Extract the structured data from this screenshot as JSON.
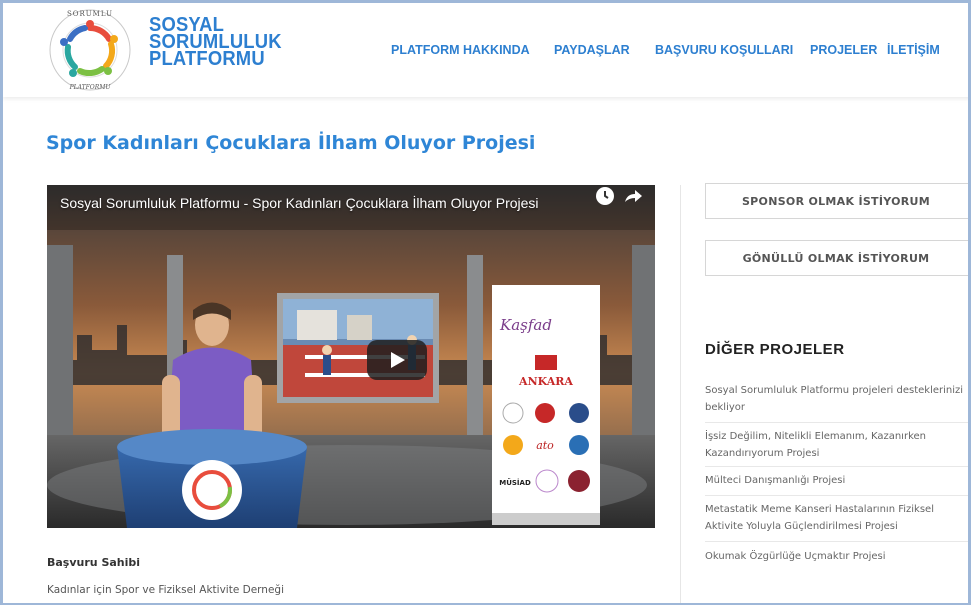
{
  "brand": {
    "line1": "SOSYAL",
    "line2": "SORUMLULUK",
    "line3": "PLATFORMU",
    "logo_ring_text": "SOSYAL SORUMLULUK PLATFORMU"
  },
  "nav": {
    "items": [
      {
        "label": "PLATFORM HAKKINDA"
      },
      {
        "label": "PAYDAŞLAR"
      },
      {
        "label": "BAŞVURU KOŞULLARI"
      },
      {
        "label": "PROJELER"
      },
      {
        "label": "İLETİŞİM"
      }
    ]
  },
  "page": {
    "title": "Spor Kadınları Çocuklara İlham Oluyor Projesi"
  },
  "video": {
    "title": "Sosyal Sorumluluk Platformu - Spor Kadınları Çocuklara İlham Oluyor Projesi",
    "icons": [
      "clock-icon",
      "share-icon",
      "play-icon"
    ],
    "banner_text_1": "Kaşfad",
    "banner_text_2": "ANKARA",
    "banner_text_3": "ato",
    "banner_text_4": "MÜSİAD"
  },
  "applicant": {
    "label": "Başvuru Sahibi",
    "value": "Kadınlar için Spor ve Fiziksel Aktivite Derneği"
  },
  "sidebar": {
    "sponsor_button": "SPONSOR OLMAK İSTİYORUM",
    "volunteer_button": "GÖNÜLLÜ OLMAK İSTİYORUM",
    "other_heading": "DİĞER PROJELER",
    "projects": [
      {
        "line1": "Sosyal Sorumluluk Platformu projeleri desteklerinizi",
        "line2": "bekliyor"
      },
      {
        "line1": "İşsiz Değilim, Nitelikli Elemanım, Kazanırken",
        "line2": "Kazandırıyorum Projesi"
      },
      {
        "line1": "Mülteci Danışmanlığı Projesi",
        "line2": ""
      },
      {
        "line1": "Metastatik Meme Kanseri Hastalarının Fiziksel",
        "line2": "Aktivite Yoluyla Güçlendirilmesi Projesi"
      },
      {
        "line1": "Okumak Özgürlüğe Uçmaktır Projesi",
        "line2": ""
      }
    ]
  },
  "colors": {
    "accent": "#2d7fd0",
    "title": "#2f86d6",
    "frame": "#9eb7d8"
  }
}
